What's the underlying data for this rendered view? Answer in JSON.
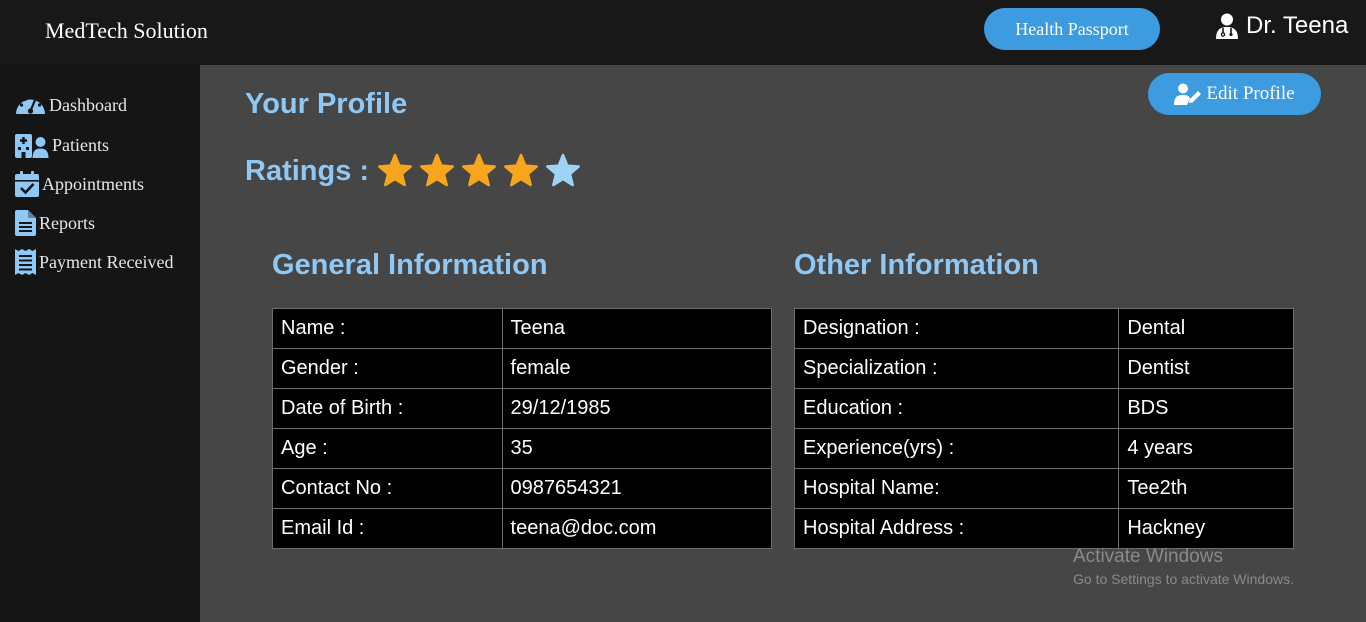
{
  "header": {
    "brand": "MedTech Solution",
    "health_passport_label": "Health Passport",
    "user_name": "Dr. Teena"
  },
  "sidebar": {
    "items": [
      {
        "label": "Dashboard",
        "icon": "dashboard-gauge-icon"
      },
      {
        "label": "Patients",
        "icon": "hospital-users-icon"
      },
      {
        "label": "Appointments",
        "icon": "calendar-check-icon"
      },
      {
        "label": "Reports",
        "icon": "file-icon"
      },
      {
        "label": "Payment Received",
        "icon": "receipt-icon"
      }
    ]
  },
  "profile": {
    "title": "Your Profile",
    "edit_label": "Edit Profile",
    "ratings_label": "Ratings :",
    "rating": {
      "filled": 4,
      "total": 5
    },
    "general": {
      "title": "General Information",
      "rows": [
        {
          "label": "Name :",
          "value": "Teena"
        },
        {
          "label": "Gender :",
          "value": "female"
        },
        {
          "label": "Date of Birth :",
          "value": "29/12/1985"
        },
        {
          "label": "Age :",
          "value": "35"
        },
        {
          "label": "Contact No :",
          "value": "0987654321"
        },
        {
          "label": "Email Id :",
          "value": "teena@doc.com"
        }
      ]
    },
    "other": {
      "title": "Other Information",
      "rows": [
        {
          "label": "Designation :",
          "value": "Dental"
        },
        {
          "label": "Specialization :",
          "value": "Dentist"
        },
        {
          "label": "Education :",
          "value": "BDS"
        },
        {
          "label": "Experience(yrs) :",
          "value": "4 years"
        },
        {
          "label": "Hospital Name:",
          "value": "Tee2th"
        },
        {
          "label": "Hospital Address :",
          "value": "Hackney"
        }
      ]
    }
  },
  "watermark": {
    "line1": "Activate Windows",
    "line2": "Go to Settings to activate Windows."
  },
  "colors": {
    "accent": "#3d9be0",
    "heading": "#8fc8f4",
    "star_filled": "#f7a51c",
    "star_empty": "#9fd3f5"
  }
}
